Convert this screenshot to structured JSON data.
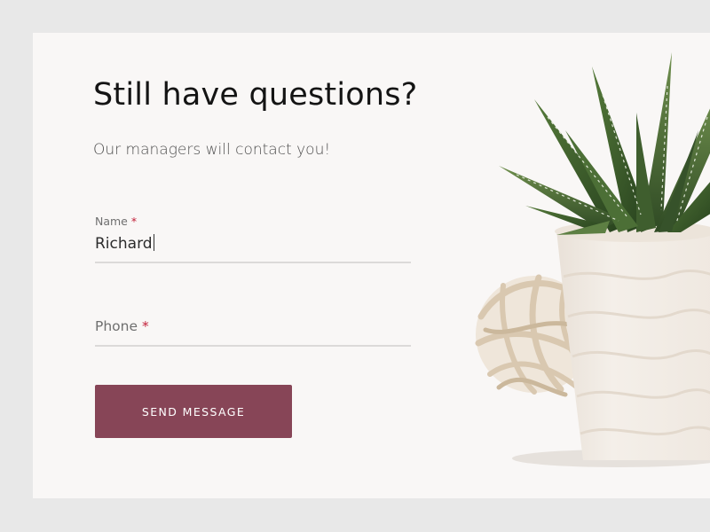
{
  "heading": {
    "title": "Still have questions?",
    "subtitle": "Our managers will contact you!"
  },
  "form": {
    "name_field": {
      "label": "Name",
      "required_mark": "*",
      "value": "Richard"
    },
    "phone_field": {
      "label": "Phone",
      "required_mark": "*",
      "value": ""
    },
    "submit_label": "SEND MESSAGE"
  },
  "colors": {
    "page_background": "#e8e8e8",
    "card_background": "#f9f7f6",
    "button": "#874557",
    "required": "#c3223b"
  }
}
